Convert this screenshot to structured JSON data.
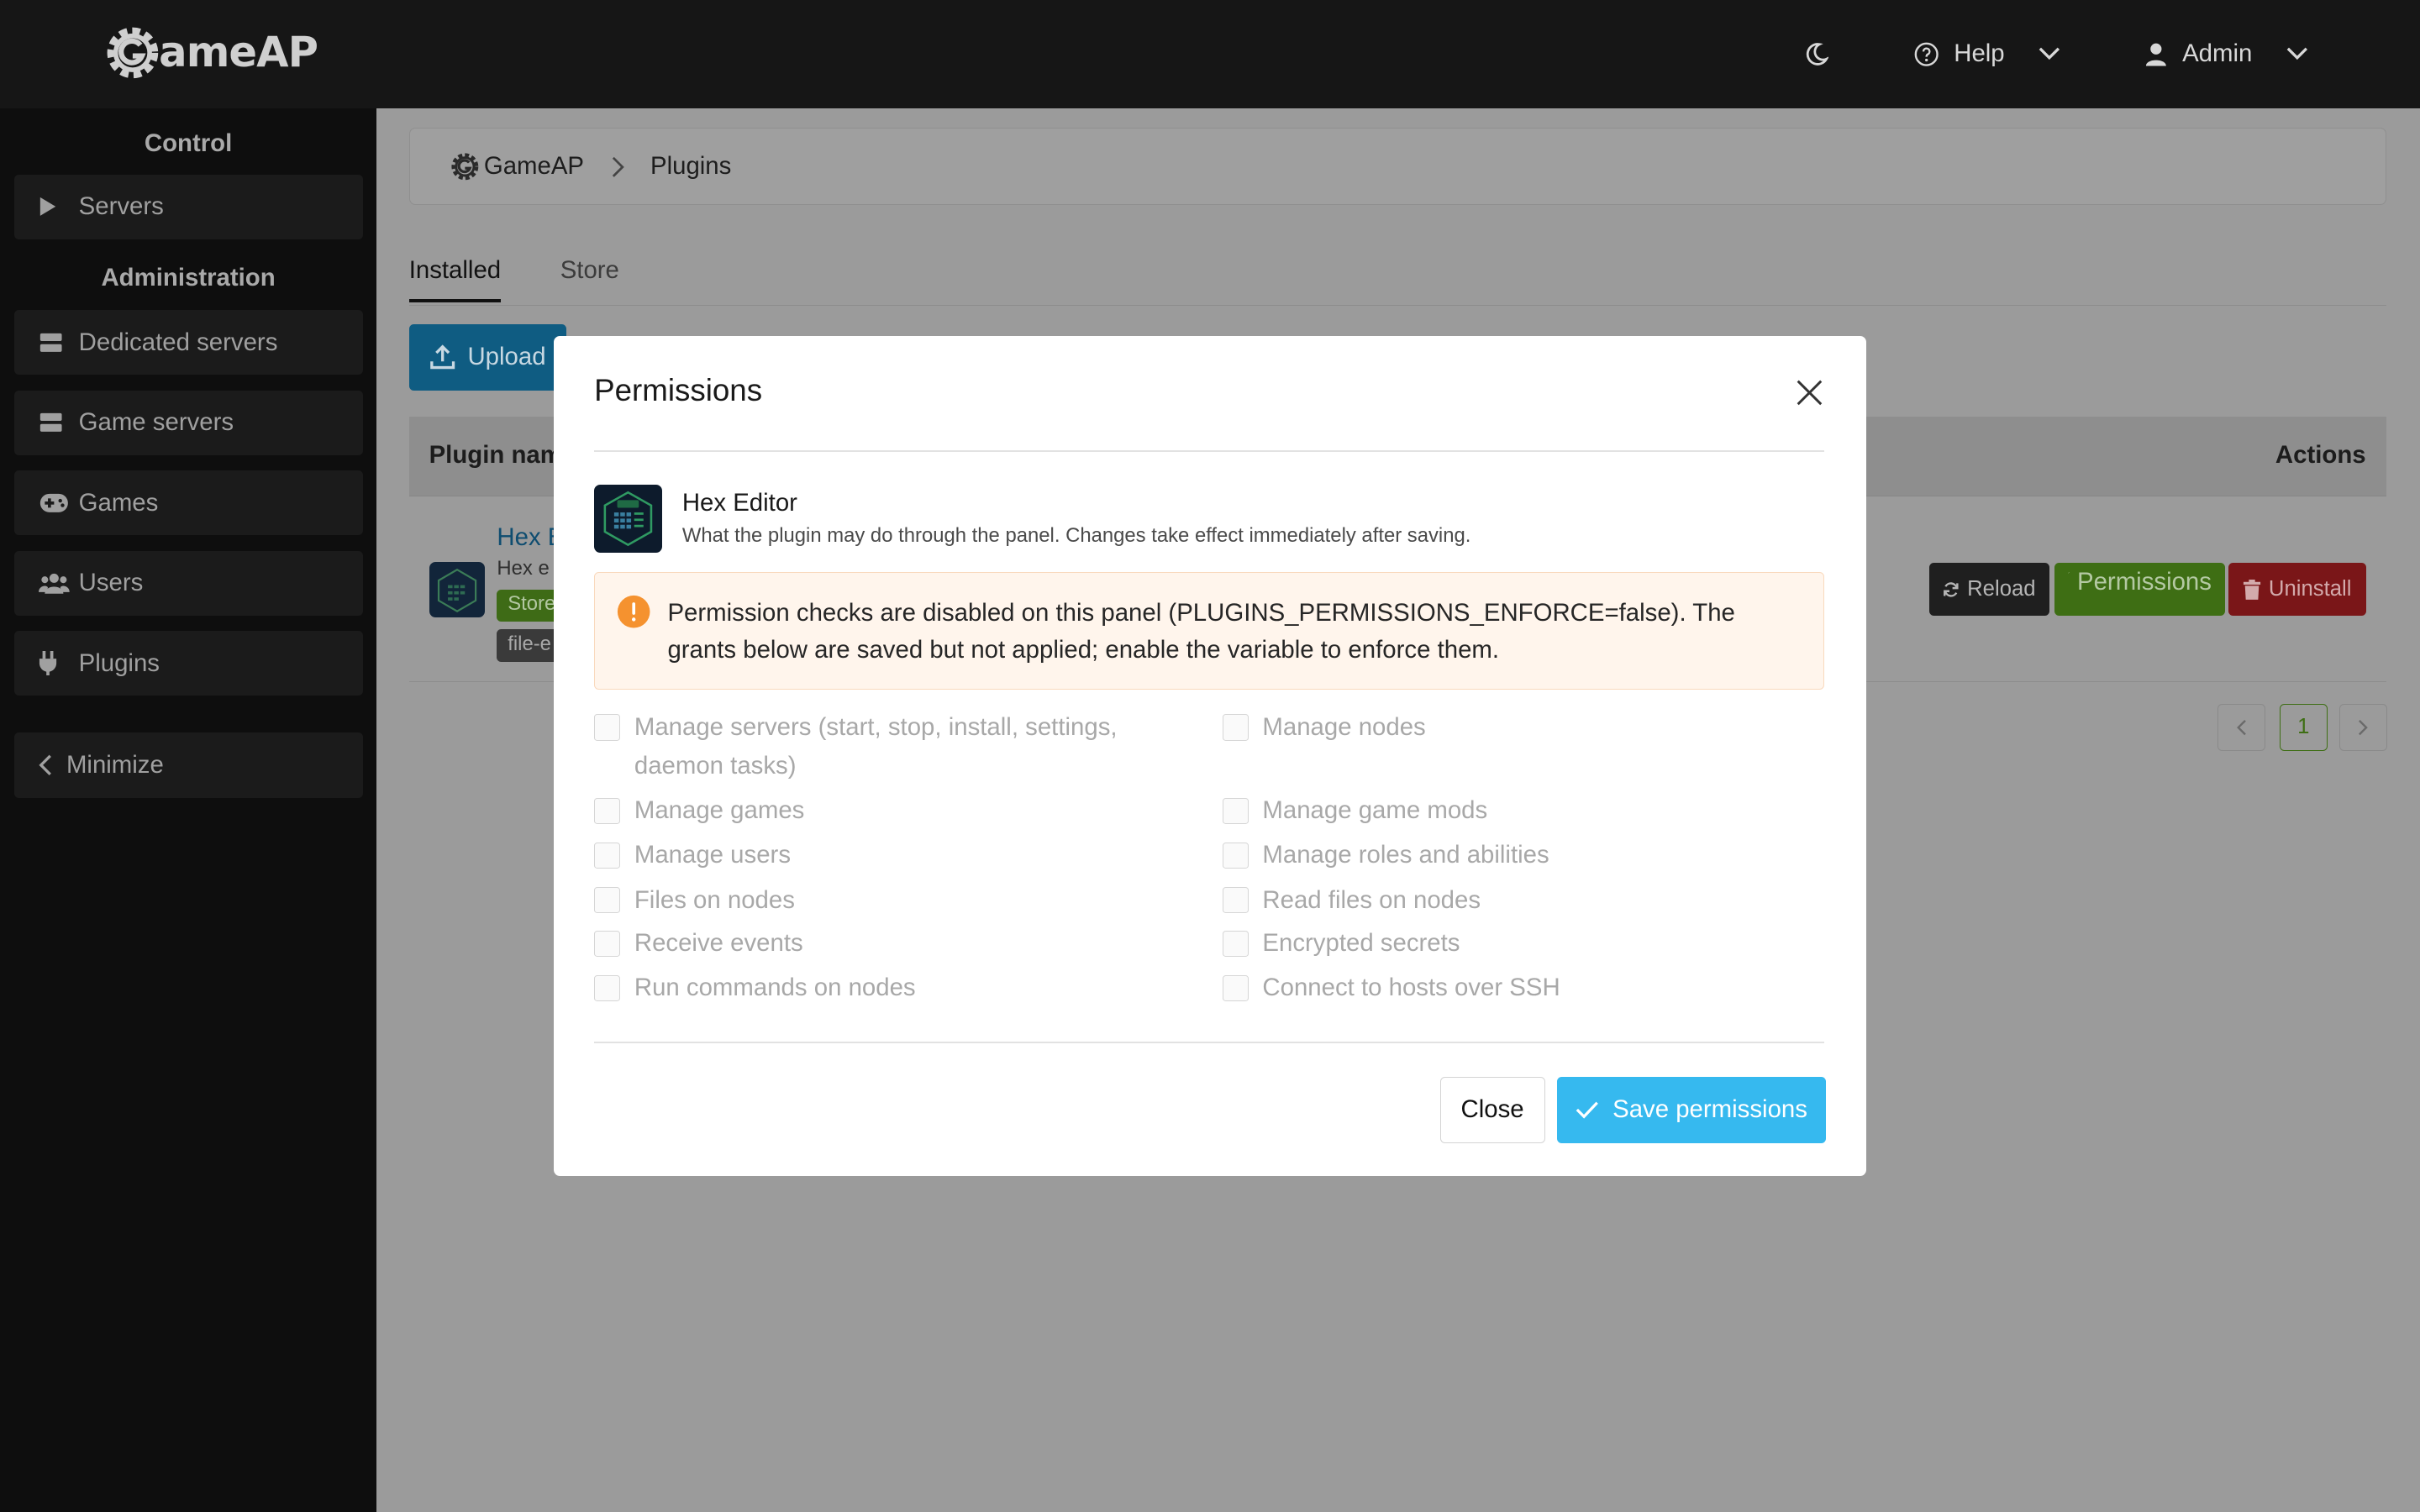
{
  "app": {
    "logo_text": "ameAP"
  },
  "topbar": {
    "help_label": "Help",
    "user_label": "Admin"
  },
  "sidebar": {
    "control_heading": "Control",
    "admin_heading": "Administration",
    "items": [
      {
        "label": "Servers",
        "icon": "play-icon"
      },
      {
        "label": "Dedicated servers",
        "icon": "server-icon"
      },
      {
        "label": "Game servers",
        "icon": "server-icon"
      },
      {
        "label": "Games",
        "icon": "gamepad-icon"
      },
      {
        "label": "Users",
        "icon": "users-icon"
      },
      {
        "label": "Plugins",
        "icon": "plug-icon"
      }
    ],
    "minimize_label": "Minimize"
  },
  "breadcrumb": {
    "home": "GameAP",
    "current": "Plugins"
  },
  "tabs": {
    "installed": "Installed",
    "store": "Store"
  },
  "upload_label": "Upload",
  "table": {
    "col_name": "Plugin nam",
    "col_actions": "Actions",
    "row": {
      "name": "Hex E",
      "desc": "Hex e",
      "tag_store": "Store",
      "tag_file": "file-e",
      "reload_label": "Reload",
      "permissions_label": "Permissions",
      "uninstall_label": "Uninstall"
    }
  },
  "pagination": {
    "current": "1"
  },
  "modal": {
    "title": "Permissions",
    "plugin_name": "Hex Editor",
    "plugin_desc": "What the plugin may do through the panel. Changes take effect immediately after saving.",
    "alert_text": "Permission checks are disabled on this panel (PLUGINS_PERMISSIONS_ENFORCE=false). The grants below are saved but not applied; enable the variable to enforce them.",
    "permissions_left": [
      "Manage servers (start, stop, install, settings, daemon tasks)",
      "Manage games",
      "Manage users",
      "Files on nodes",
      "Receive events",
      "Run commands on nodes"
    ],
    "permissions_right": [
      "Manage nodes",
      "Manage game mods",
      "Manage roles and abilities",
      "Read files on nodes",
      "Encrypted secrets",
      "Connect to hosts over SSH"
    ],
    "close_label": "Close",
    "save_label": "Save permissions"
  },
  "colors": {
    "accent": "#36b9ef",
    "warning": "#f5922f",
    "success": "#5cb82a",
    "danger": "#d92a2e"
  }
}
